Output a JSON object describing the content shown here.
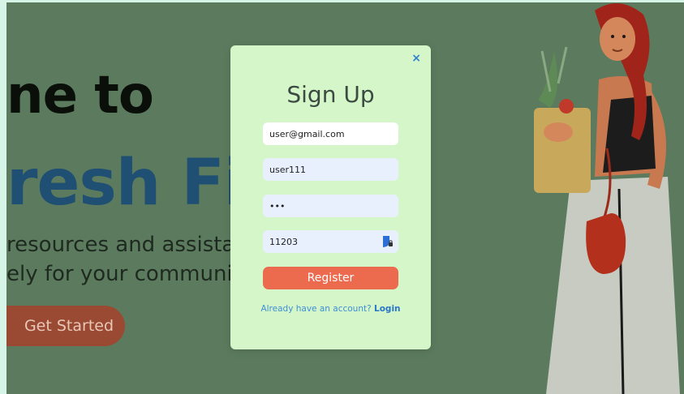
{
  "hero": {
    "line1": "ne to",
    "line2": "resh Fi",
    "sub1": "resources and assista",
    "sub2": "ely for your communi",
    "cta": "Get Started"
  },
  "modal": {
    "title": "Sign Up",
    "close": "×",
    "email": "user@gmail.com",
    "username": "user111",
    "password": "•••",
    "code": "11203",
    "register": "Register",
    "login_prompt": "Already have an account?",
    "login_link": "Login"
  },
  "colors": {
    "backdrop": "#5c7b5e",
    "modal_bg": "#d4f6c8",
    "accent": "#ec6a4e",
    "link": "#2a77c8"
  },
  "icons": {
    "close": "close-icon",
    "password_manager": "password-manager-icon"
  }
}
